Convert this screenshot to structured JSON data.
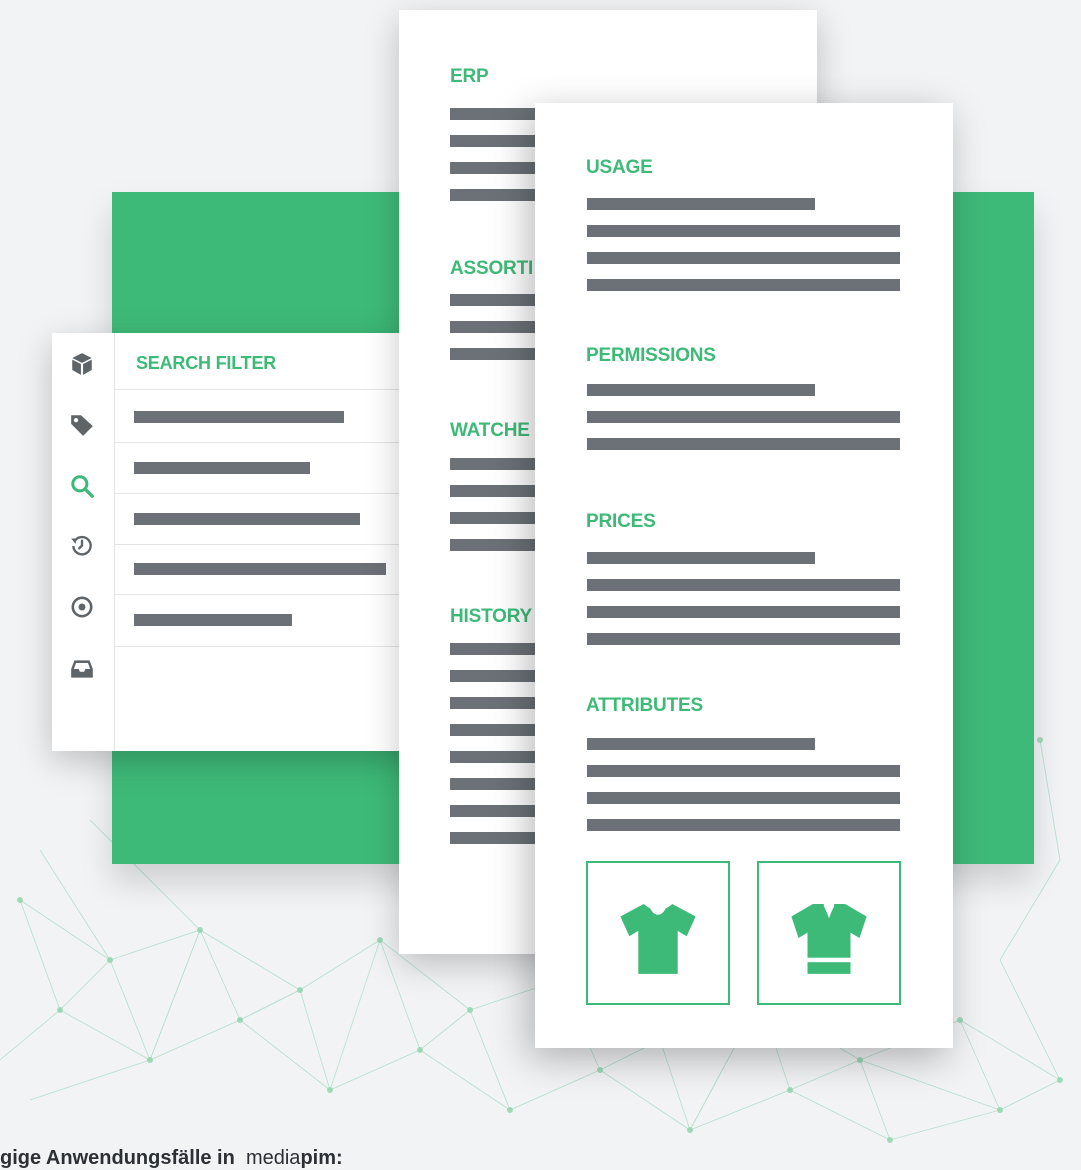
{
  "search_card": {
    "title": "SEARCH FILTER",
    "sidebar_icons": [
      "cube-icon",
      "tag-icon",
      "search-icon",
      "history-icon",
      "eye-icon",
      "inbox-icon"
    ],
    "active_icon": "search-icon"
  },
  "middle_card": {
    "sections": [
      "ERP",
      "ASSORTI",
      "WATCHE",
      "HISTORY"
    ]
  },
  "front_card": {
    "sections": [
      "USAGE",
      "PERMISSIONS",
      "PRICES",
      "ATTRIBUTES"
    ],
    "tiles": [
      "tshirt-icon",
      "jersey-icon"
    ]
  },
  "caption": {
    "bold": "gige Anwendungsfälle in",
    "brand_light": "media",
    "brand_bold": "pim:"
  },
  "colors": {
    "accent": "#3eba78",
    "bar": "#6b7177",
    "icon": "#5f6469",
    "background": "#f1f3f5"
  }
}
